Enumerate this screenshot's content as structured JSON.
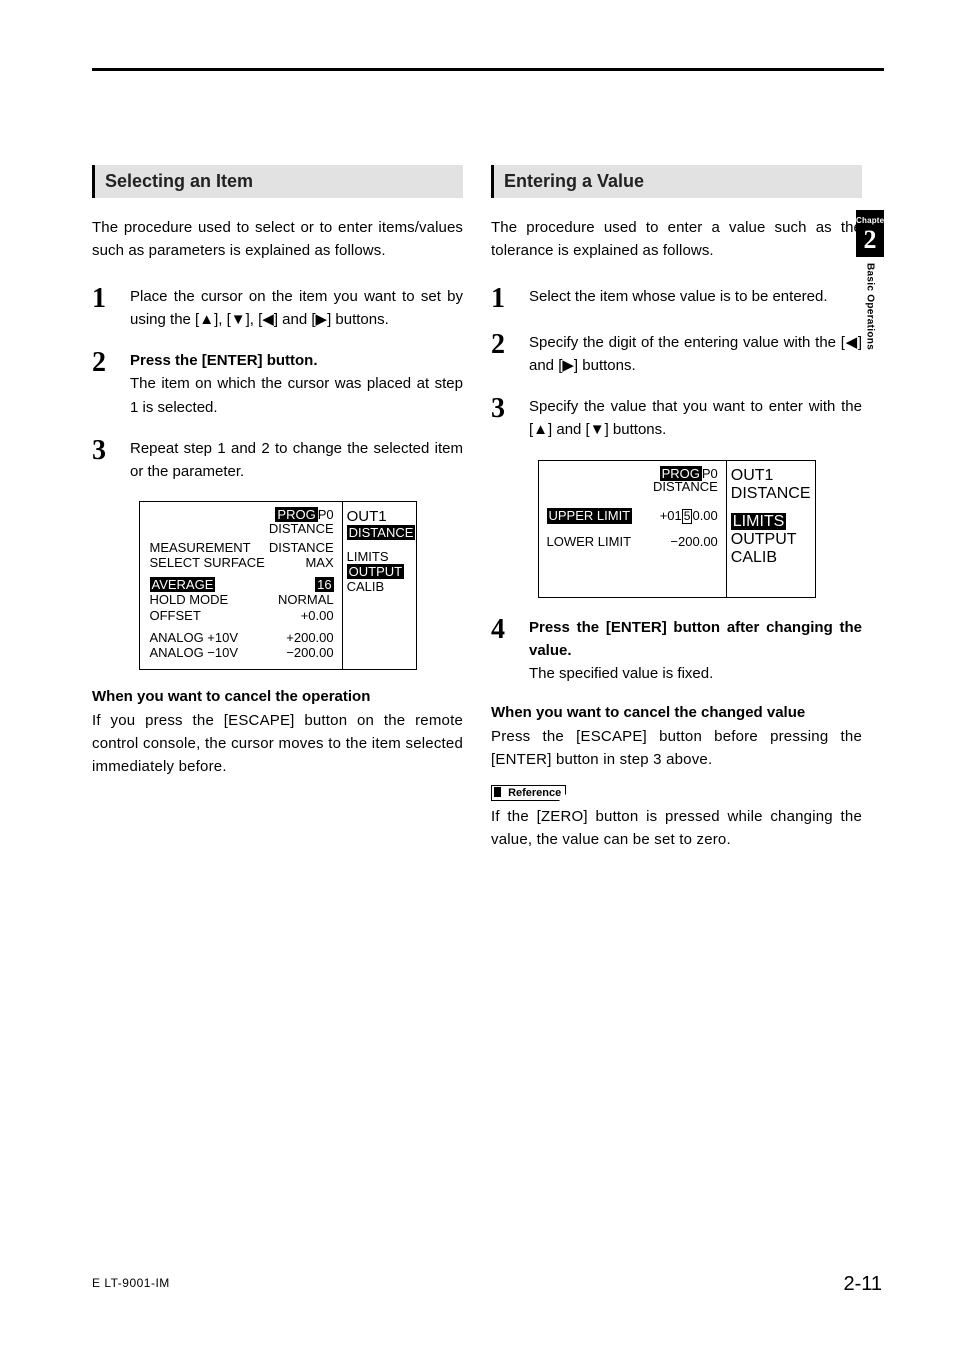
{
  "tab": {
    "chapter_label": "Chapter",
    "chapter_num": "2",
    "chapter_title": "Basic Operations"
  },
  "footer": {
    "left": "E LT-9001-IM",
    "right": "2-11"
  },
  "glyphs": {
    "up": "▲",
    "down": "▼",
    "left": "◀",
    "right": "▶"
  },
  "left": {
    "title": "Selecting an Item",
    "intro": "The procedure used to select or to enter items/values such as parameters is explained as follows.",
    "step1_a": "Place the cursor on the item you want to set by using the [",
    "step1_b": "], [",
    "step1_c": "], [",
    "step1_d": "] and [",
    "step1_e": "] buttons.",
    "step2_head": "Press the [ENTER] button.",
    "step2_body": "The item on which the cursor was placed at step 1 is selected.",
    "step3": "Repeat step 1 and 2 to change the selected item or the parameter.",
    "cancel_head": "When you want to cancel the operation",
    "cancel_body": "If you press the [ESCAPE] button on the remote control console, the cursor moves to the item selected immediately before.",
    "fig": {
      "prog": "PROG",
      "p0": "P0",
      "dist": "DISTANCE",
      "out1": "OUT1",
      "side": {
        "limits": "LIMITS",
        "output": "OUTPUT",
        "calib": "CALIB"
      },
      "rows": {
        "measurement": "MEASUREMENT",
        "distance": "DISTANCE",
        "select_surface": "SELECT SURFACE",
        "max": "MAX",
        "average": "AVERAGE",
        "avg_val": "16",
        "hold_mode": "HOLD MODE",
        "normal": "NORMAL",
        "offset": "OFFSET",
        "offset_val": "+0.00",
        "ap10": "ANALOG +10V",
        "ap10_val": "+200.00",
        "am10": "ANALOG −10V",
        "am10_val": "−200.00"
      }
    }
  },
  "right": {
    "title": "Entering a Value",
    "intro": "The procedure used to enter a value such as the tolerance is explained as follows.",
    "step1": "Select the item whose value is to be entered.",
    "step2_a": "Specify the digit of the entering value with the [",
    "step2_b": "] and [",
    "step2_c": "] buttons.",
    "step3_a": "Specify the value that you want to enter with the [",
    "step3_b": "] and [",
    "step3_c": "] buttons.",
    "step4_head": "Press the [ENTER] button after changing the value.",
    "step4_body": "The specified value is fixed.",
    "cancel_head": "When you want to cancel the changed value",
    "cancel_body": "Press the [ESCAPE] button before pressing the [ENTER] button in step 3 above.",
    "ref_label": "Reference",
    "ref_body": "If the [ZERO] button is pressed while changing the value, the value can be set to zero.",
    "fig": {
      "prog": "PROG",
      "p0": "P0",
      "dist": "DISTANCE",
      "out1": "OUT1",
      "side": {
        "limits": "LIMITS",
        "output": "OUTPUT",
        "calib": "CALIB"
      },
      "upper": "UPPER LIMIT",
      "upper_val_a": "+01",
      "upper_val_digit": "5",
      "upper_val_b": "0.00",
      "lower": "LOWER LIMIT",
      "lower_val": "−200.00"
    }
  }
}
